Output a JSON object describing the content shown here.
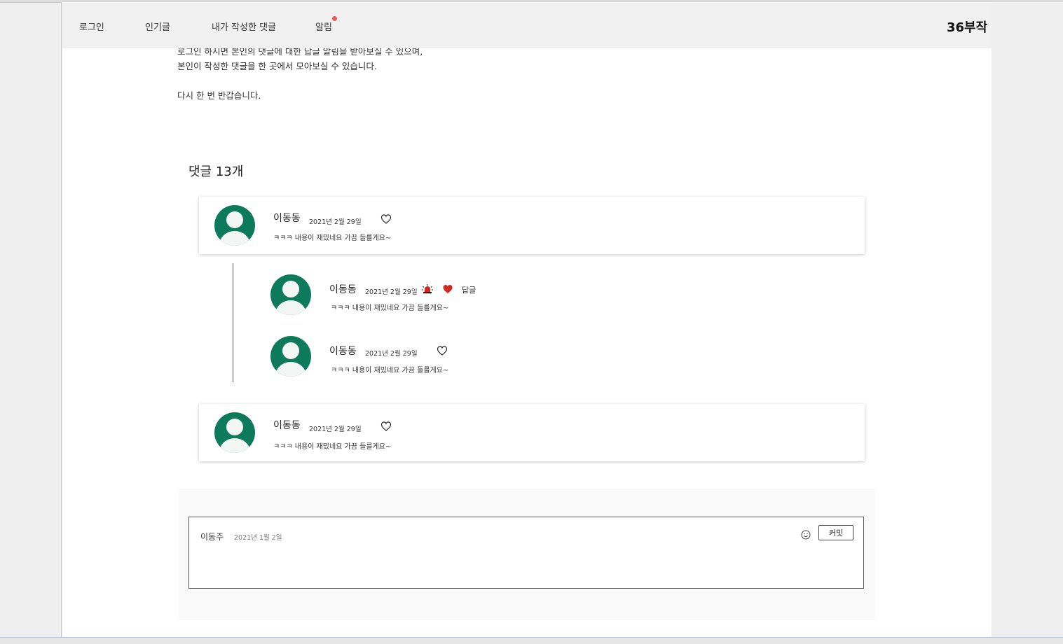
{
  "nav": {
    "items": [
      "로그인",
      "인기글",
      "내가 작성한 댓글",
      "알림"
    ],
    "brand": "36부작"
  },
  "intro": {
    "lines": [
      "로그인 하시면 본인의 댓글에 대한 답글 알림을 받아보실 수 있으며,",
      "본인이 작성한 댓글을 한 곳에서 모아보실 수 있습니다.",
      "다시 한 번 반갑습니다."
    ]
  },
  "comments": {
    "count_label": "댓글 13개",
    "list": [
      {
        "name": "이동동",
        "date": "2021년 2월 29일",
        "text": "ㅋㅋㅋ 내용이 재밌네요 가끔 들를게요~",
        "liked": false
      },
      {
        "name": "이동동",
        "date": "2021년 2월 29일",
        "text": "ㅋㅋㅋ 내용이 재밌네요 가끔 들를게요~",
        "liked": true,
        "reply_label": "답글",
        "report_icon": "siren-icon"
      },
      {
        "name": "이동동",
        "date": "2021년 2월 29일",
        "text": "ㅋㅋㅋ 내용이 재밌네요 가끔 들를게요~",
        "liked": false
      },
      {
        "name": "이동동",
        "date": "2021년 2월 29일",
        "text": "ㅋㅋㅋ 내용이 재밌네요 가끔 들를게요~",
        "liked": false
      }
    ]
  },
  "editor": {
    "name": "이동주",
    "date": "2021년 1월 2일",
    "submit_label": "커밋",
    "emoji_icon": "smile-icon"
  },
  "colors": {
    "avatar": "#0e7a5c",
    "like": "#d2281e",
    "notification_dot": "#f05a5a"
  }
}
